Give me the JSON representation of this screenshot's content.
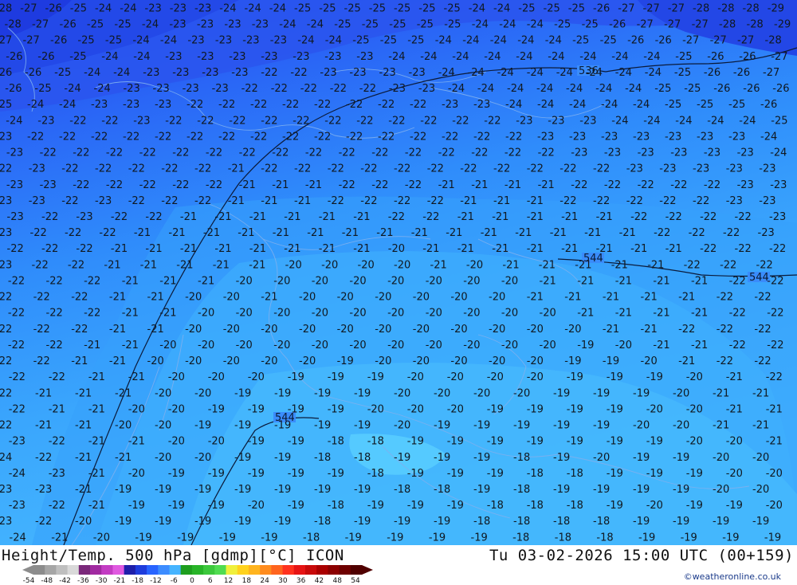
{
  "title": "Height/Temp. 500 hPa [gdmp][°C] ICON",
  "datetime": "Tu 03-02-2026 15:00 UTC (00+159)",
  "credit": "©weatheronline.co.uk",
  "contour_labels": [
    "536",
    "544",
    "544",
    "544"
  ],
  "colorbar": {
    "labels": [
      "-54",
      "-48",
      "-42",
      "-36",
      "-30",
      "-21",
      "-18",
      "-12",
      "-6",
      "0",
      "6",
      "12",
      "18",
      "24",
      "30",
      "36",
      "42",
      "48",
      "54"
    ],
    "colors": [
      "#8c8c8c",
      "#a6a6a6",
      "#bfbfbf",
      "#d9d9d9",
      "#7a287a",
      "#a12aa1",
      "#c33cc3",
      "#e05ae0",
      "#1e1eaa",
      "#1e3cdc",
      "#2864ff",
      "#3c8cff",
      "#46b4ff",
      "#1e9e1e",
      "#28b428",
      "#3cc83c",
      "#50dc50",
      "#f0f03c",
      "#ffd21e",
      "#ffb41e",
      "#ff8c1e",
      "#ff641e",
      "#ff321e",
      "#e61414",
      "#c80a0a",
      "#aa0000",
      "#8c0000",
      "#6e0000",
      "#500000"
    ]
  },
  "temperature_rows": [
    {
      "row": 0,
      "values": [
        "28",
        "27",
        "26",
        "25",
        "24",
        "24",
        "23",
        "23",
        "23",
        "24",
        "24",
        "24",
        "25",
        "25",
        "25",
        "25",
        "25",
        "25",
        "25",
        "24",
        "24",
        "25",
        "25",
        "25",
        "26",
        "27",
        "27",
        "27",
        "28",
        "28",
        "28",
        "29"
      ]
    },
    {
      "row": 1,
      "values": [
        "28",
        "27",
        "26",
        "25",
        "25",
        "24",
        "23",
        "23",
        "23",
        "23",
        "24",
        "24",
        "25",
        "25",
        "25",
        "25",
        "25",
        "24",
        "24",
        "24",
        "25",
        "25",
        "26",
        "27",
        "27",
        "27",
        "28",
        "28",
        "29"
      ]
    },
    {
      "row": 2,
      "values": [
        "27",
        "27",
        "26",
        "25",
        "25",
        "24",
        "24",
        "23",
        "23",
        "23",
        "23",
        "24",
        "24",
        "25",
        "25",
        "25",
        "24",
        "24",
        "24",
        "24",
        "24",
        "25",
        "25",
        "26",
        "26",
        "27",
        "27",
        "27",
        "28"
      ]
    },
    {
      "row": 3,
      "values": [
        "26",
        "26",
        "25",
        "24",
        "24",
        "23",
        "23",
        "23",
        "23",
        "23",
        "23",
        "23",
        "24",
        "24",
        "24",
        "24",
        "24",
        "24",
        "24",
        "24",
        "24",
        "25",
        "26",
        "26",
        "27"
      ]
    },
    {
      "row": 4,
      "values": [
        "26",
        "26",
        "25",
        "24",
        "24",
        "23",
        "23",
        "23",
        "23",
        "22",
        "22",
        "23",
        "23",
        "23",
        "23",
        "24",
        "24",
        "24",
        "24",
        "24",
        "24",
        "24",
        "24",
        "25",
        "26",
        "26",
        "27"
      ]
    },
    {
      "row": 5,
      "values": [
        "26",
        "25",
        "24",
        "24",
        "23",
        "23",
        "23",
        "23",
        "22",
        "22",
        "22",
        "22",
        "22",
        "23",
        "23",
        "24",
        "24",
        "24",
        "24",
        "24",
        "24",
        "24",
        "25",
        "25",
        "26",
        "26",
        "26"
      ]
    },
    {
      "row": 6,
      "values": [
        "25",
        "24",
        "24",
        "23",
        "23",
        "23",
        "22",
        "22",
        "22",
        "22",
        "22",
        "22",
        "22",
        "22",
        "23",
        "23",
        "24",
        "24",
        "24",
        "24",
        "24",
        "25",
        "25",
        "25",
        "26"
      ]
    },
    {
      "row": 7,
      "values": [
        "24",
        "23",
        "22",
        "22",
        "23",
        "22",
        "22",
        "22",
        "22",
        "22",
        "22",
        "22",
        "22",
        "22",
        "22",
        "22",
        "23",
        "23",
        "23",
        "24",
        "24",
        "24",
        "24",
        "24",
        "25"
      ]
    },
    {
      "row": 8,
      "values": [
        "23",
        "22",
        "22",
        "22",
        "22",
        "22",
        "22",
        "22",
        "22",
        "22",
        "22",
        "22",
        "22",
        "22",
        "22",
        "22",
        "22",
        "23",
        "23",
        "23",
        "23",
        "23",
        "23",
        "23",
        "24"
      ]
    },
    {
      "row": 9,
      "values": [
        "23",
        "22",
        "22",
        "22",
        "22",
        "22",
        "22",
        "22",
        "22",
        "22",
        "22",
        "22",
        "22",
        "22",
        "22",
        "22",
        "22",
        "23",
        "23",
        "23",
        "23",
        "23",
        "23",
        "24"
      ]
    },
    {
      "row": 10,
      "values": [
        "22",
        "23",
        "22",
        "22",
        "22",
        "22",
        "22",
        "21",
        "22",
        "22",
        "22",
        "22",
        "22",
        "22",
        "22",
        "22",
        "22",
        "22",
        "22",
        "23",
        "23",
        "23",
        "23",
        "23"
      ]
    },
    {
      "row": 11,
      "values": [
        "23",
        "23",
        "22",
        "22",
        "22",
        "22",
        "22",
        "21",
        "21",
        "21",
        "22",
        "22",
        "22",
        "21",
        "21",
        "21",
        "21",
        "22",
        "22",
        "22",
        "22",
        "22",
        "23",
        "23"
      ]
    },
    {
      "row": 12,
      "values": [
        "23",
        "23",
        "22",
        "23",
        "22",
        "22",
        "22",
        "21",
        "21",
        "21",
        "22",
        "22",
        "22",
        "22",
        "21",
        "21",
        "21",
        "22",
        "22",
        "22",
        "22",
        "22",
        "23",
        "23"
      ]
    },
    {
      "row": 13,
      "values": [
        "23",
        "22",
        "23",
        "22",
        "22",
        "21",
        "21",
        "21",
        "21",
        "21",
        "21",
        "22",
        "22",
        "21",
        "21",
        "21",
        "21",
        "21",
        "22",
        "22",
        "22",
        "22",
        "23"
      ]
    },
    {
      "row": 14,
      "values": [
        "23",
        "22",
        "22",
        "22",
        "21",
        "21",
        "21",
        "21",
        "21",
        "21",
        "21",
        "21",
        "21",
        "21",
        "21",
        "21",
        "21",
        "21",
        "21",
        "22",
        "22",
        "22",
        "23"
      ]
    },
    {
      "row": 15,
      "values": [
        "22",
        "22",
        "22",
        "21",
        "21",
        "21",
        "21",
        "21",
        "21",
        "21",
        "21",
        "20",
        "21",
        "21",
        "21",
        "21",
        "21",
        "21",
        "21",
        "21",
        "22",
        "22",
        "22"
      ]
    },
    {
      "row": 16,
      "values": [
        "23",
        "22",
        "22",
        "21",
        "21",
        "21",
        "21",
        "21",
        "20",
        "20",
        "20",
        "20",
        "21",
        "20",
        "21",
        "21",
        "21",
        "21",
        "21",
        "22",
        "22",
        "22"
      ]
    },
    {
      "row": 17,
      "values": [
        "22",
        "22",
        "22",
        "21",
        "21",
        "21",
        "20",
        "20",
        "20",
        "20",
        "20",
        "20",
        "20",
        "20",
        "21",
        "21",
        "21",
        "21",
        "21",
        "22",
        "22"
      ]
    },
    {
      "row": 18,
      "values": [
        "22",
        "22",
        "22",
        "21",
        "21",
        "20",
        "20",
        "21",
        "20",
        "20",
        "20",
        "20",
        "20",
        "20",
        "21",
        "21",
        "21",
        "21",
        "21",
        "22",
        "22"
      ]
    },
    {
      "row": 19,
      "values": [
        "22",
        "22",
        "22",
        "21",
        "21",
        "20",
        "20",
        "20",
        "20",
        "20",
        "20",
        "20",
        "20",
        "20",
        "20",
        "21",
        "21",
        "21",
        "21",
        "22",
        "22"
      ]
    },
    {
      "row": 20,
      "values": [
        "22",
        "22",
        "22",
        "21",
        "21",
        "20",
        "20",
        "20",
        "20",
        "20",
        "20",
        "20",
        "20",
        "20",
        "20",
        "20",
        "21",
        "21",
        "22",
        "22",
        "22"
      ]
    },
    {
      "row": 21,
      "values": [
        "22",
        "22",
        "21",
        "21",
        "20",
        "20",
        "20",
        "20",
        "20",
        "20",
        "20",
        "20",
        "20",
        "20",
        "20",
        "19",
        "20",
        "21",
        "21",
        "22",
        "22"
      ]
    },
    {
      "row": 22,
      "values": [
        "22",
        "22",
        "21",
        "21",
        "20",
        "20",
        "20",
        "20",
        "20",
        "19",
        "20",
        "20",
        "20",
        "20",
        "20",
        "19",
        "19",
        "20",
        "21",
        "22",
        "22"
      ]
    },
    {
      "row": 23,
      "values": [
        "22",
        "22",
        "21",
        "21",
        "20",
        "20",
        "20",
        "19",
        "19",
        "19",
        "20",
        "20",
        "20",
        "20",
        "19",
        "19",
        "19",
        "20",
        "21",
        "22"
      ]
    },
    {
      "row": 24,
      "values": [
        "22",
        "21",
        "21",
        "21",
        "20",
        "20",
        "19",
        "19",
        "19",
        "19",
        "20",
        "20",
        "20",
        "20",
        "19",
        "19",
        "19",
        "20",
        "21",
        "21"
      ]
    },
    {
      "row": 25,
      "values": [
        "22",
        "21",
        "21",
        "20",
        "20",
        "19",
        "19",
        "19",
        "19",
        "20",
        "20",
        "20",
        "19",
        "19",
        "19",
        "19",
        "20",
        "20",
        "21",
        "21"
      ]
    },
    {
      "row": 26,
      "values": [
        "22",
        "21",
        "21",
        "20",
        "20",
        "19",
        "19",
        "19",
        "19",
        "19",
        "20",
        "19",
        "19",
        "19",
        "19",
        "19",
        "20",
        "20",
        "21",
        "21"
      ]
    },
    {
      "row": 27,
      "values": [
        "23",
        "22",
        "21",
        "21",
        "20",
        "20",
        "19",
        "19",
        "18",
        "18",
        "19",
        "19",
        "19",
        "19",
        "19",
        "19",
        "19",
        "20",
        "20",
        "21"
      ]
    },
    {
      "row": 28,
      "values": [
        "24",
        "22",
        "21",
        "21",
        "20",
        "20",
        "19",
        "19",
        "18",
        "18",
        "19",
        "19",
        "19",
        "18",
        "19",
        "20",
        "19",
        "19",
        "20",
        "20"
      ]
    },
    {
      "row": 29,
      "values": [
        "24",
        "23",
        "21",
        "20",
        "19",
        "19",
        "19",
        "19",
        "19",
        "18",
        "19",
        "19",
        "19",
        "18",
        "18",
        "19",
        "19",
        "19",
        "20",
        "20"
      ]
    },
    {
      "row": 30,
      "values": [
        "23",
        "23",
        "21",
        "19",
        "19",
        "19",
        "19",
        "19",
        "19",
        "19",
        "18",
        "18",
        "19",
        "18",
        "19",
        "19",
        "19",
        "19",
        "20",
        "20"
      ]
    },
    {
      "row": 31,
      "values": [
        "23",
        "22",
        "21",
        "19",
        "19",
        "19",
        "20",
        "19",
        "18",
        "19",
        "19",
        "19",
        "18",
        "18",
        "18",
        "19",
        "20",
        "19",
        "19",
        "20"
      ]
    },
    {
      "row": 32,
      "values": [
        "23",
        "22",
        "20",
        "19",
        "19",
        "19",
        "19",
        "19",
        "18",
        "19",
        "19",
        "19",
        "18",
        "18",
        "18",
        "18",
        "19",
        "19",
        "19",
        "19"
      ]
    },
    {
      "row": 33,
      "values": [
        "24",
        "21",
        "20",
        "19",
        "19",
        "19",
        "19",
        "18",
        "19",
        "19",
        "19",
        "19",
        "18",
        "18",
        "18",
        "19",
        "19",
        "19",
        "19"
      ]
    }
  ]
}
